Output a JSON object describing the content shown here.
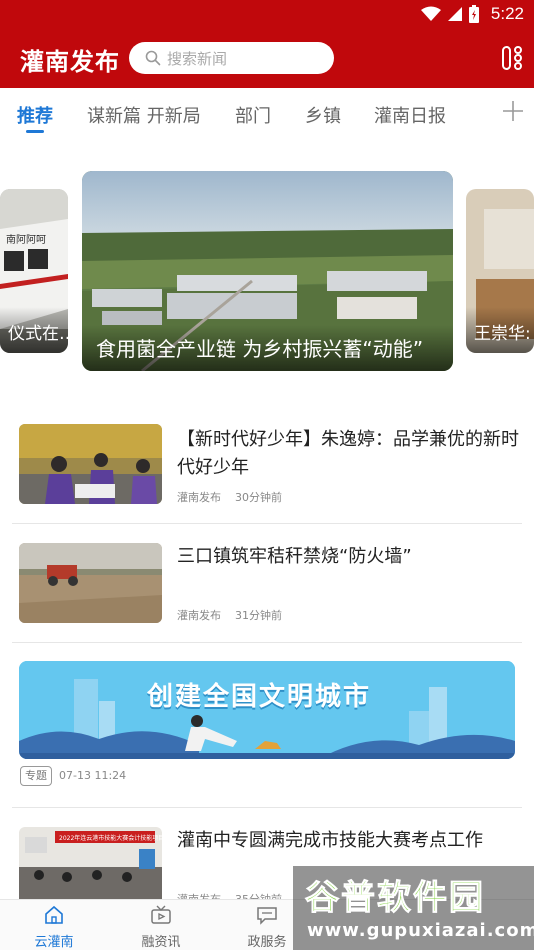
{
  "status_bar": {
    "time": "5:22"
  },
  "header": {
    "title": "灌南发布",
    "search_placeholder": "搜索新闻"
  },
  "tabs": [
    {
      "label": "推荐",
      "active": true
    },
    {
      "label": "谋新篇 开新局"
    },
    {
      "label": "部门"
    },
    {
      "label": "乡镇"
    },
    {
      "label": "灌南日报"
    }
  ],
  "carousel": {
    "left_caption": "仪式在…",
    "left_sign_text": "南阿阿呵",
    "center_caption": "食用菌全产业链 为乡村振兴蓄“动能”",
    "right_caption": "王崇华:"
  },
  "news": [
    {
      "title": "【新时代好少年】朱逸婷：品学兼优的新时代好少年",
      "source": "灌南发布",
      "time": "30分钟前"
    },
    {
      "title": "三口镇筑牢秸秆禁烧“防火墙”",
      "source": "灌南发布",
      "time": "31分钟前"
    },
    {
      "title": "灌南中专圆满完成市技能大赛考点工作",
      "source": "灌南发布",
      "time": "35分钟前",
      "photo_banner": "2022年连云港市技能大赛会计技能项目"
    }
  ],
  "banner": {
    "text": "创建全国文明城市",
    "tag": "专题",
    "time": "07-13 11:24"
  },
  "bottom_nav": [
    {
      "label": "云灌南",
      "icon": "home-icon",
      "active": true
    },
    {
      "label": "融资讯",
      "icon": "tv-icon"
    },
    {
      "label": "政服务",
      "icon": "message-icon"
    }
  ],
  "watermark": {
    "name": "谷普软件园",
    "url": "www.gupuxiazai.com"
  },
  "colors": {
    "brand_red": "#c0080c",
    "accent_blue": "#1e78d6"
  }
}
